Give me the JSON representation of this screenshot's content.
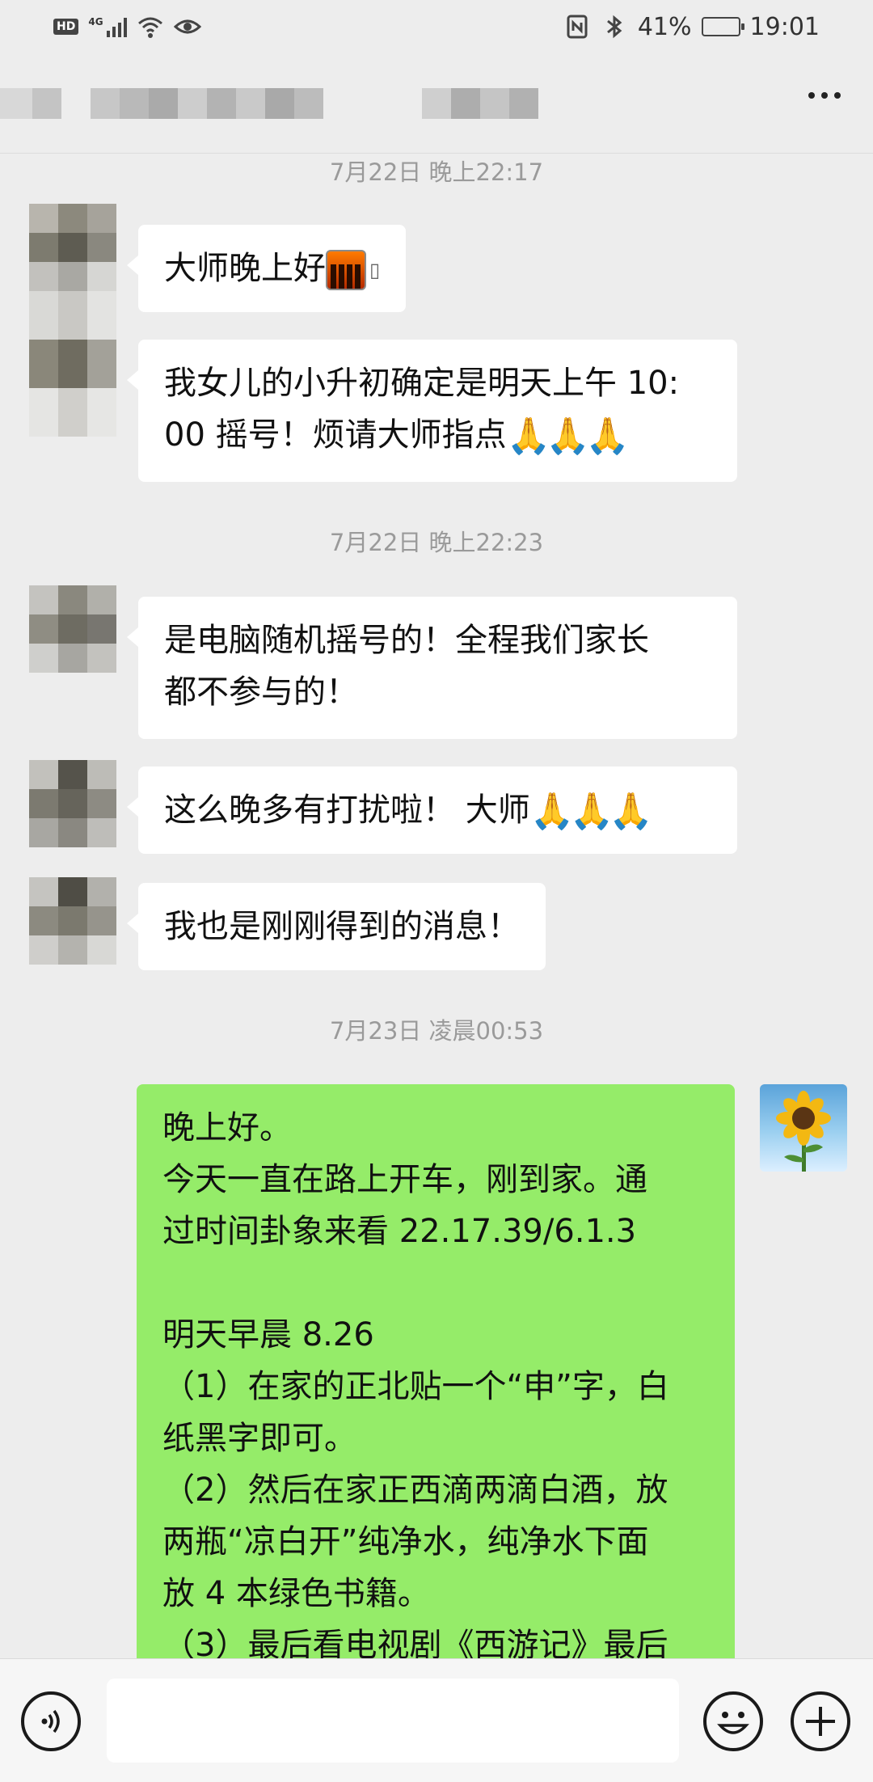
{
  "status_bar": {
    "hd": "HD",
    "network": "4G",
    "battery": "41%",
    "battery_level": 0.41,
    "time": "19:01"
  },
  "titlebar": {
    "more_icon": "more-dots-icon"
  },
  "chat": {
    "timestamps": [
      "7月22日 晚上22:17",
      "7月22日 晚上22:23",
      "7月23日 凌晨00:53"
    ],
    "messages": [
      {
        "side": "left",
        "lines": [
          "大师晚上好"
        ],
        "trailing": "🌆"
      },
      {
        "side": "left",
        "lines": [
          "我女儿的小升初确定是明天上午 10:",
          "00 摇号！烦请大师指点"
        ],
        "trailing": "🙏🙏🙏"
      },
      {
        "side": "left",
        "lines": [
          "是电脑随机摇号的！全程我们家长",
          "都不参与的！"
        ]
      },
      {
        "side": "left",
        "lines": [
          "这么晚多有打扰啦！ 大师"
        ],
        "trailing": "🙏🙏🙏"
      },
      {
        "side": "left",
        "lines": [
          "我也是刚刚得到的消息！"
        ]
      },
      {
        "side": "right",
        "lines": [
          "晚上好。",
          "今天一直在路上开车，刚到家。通",
          "过时间卦象来看 22.17.39/6.1.3",
          "",
          "明天早晨 8.26",
          "（1）在家的正北贴一个“申”字，白",
          "纸黑字即可。",
          "（2）然后在家正西滴两滴白酒，放",
          "两瓶“凉白开”纯净水，纯净水下面",
          "放 4 本绿色书籍。",
          "（3）最后看电视剧《西游记》最后"
        ]
      }
    ]
  },
  "input_bar": {
    "voice_icon": "voice-icon",
    "emoji_icon": "emoji-icon",
    "plus_icon": "plus-icon",
    "input_value": ""
  }
}
